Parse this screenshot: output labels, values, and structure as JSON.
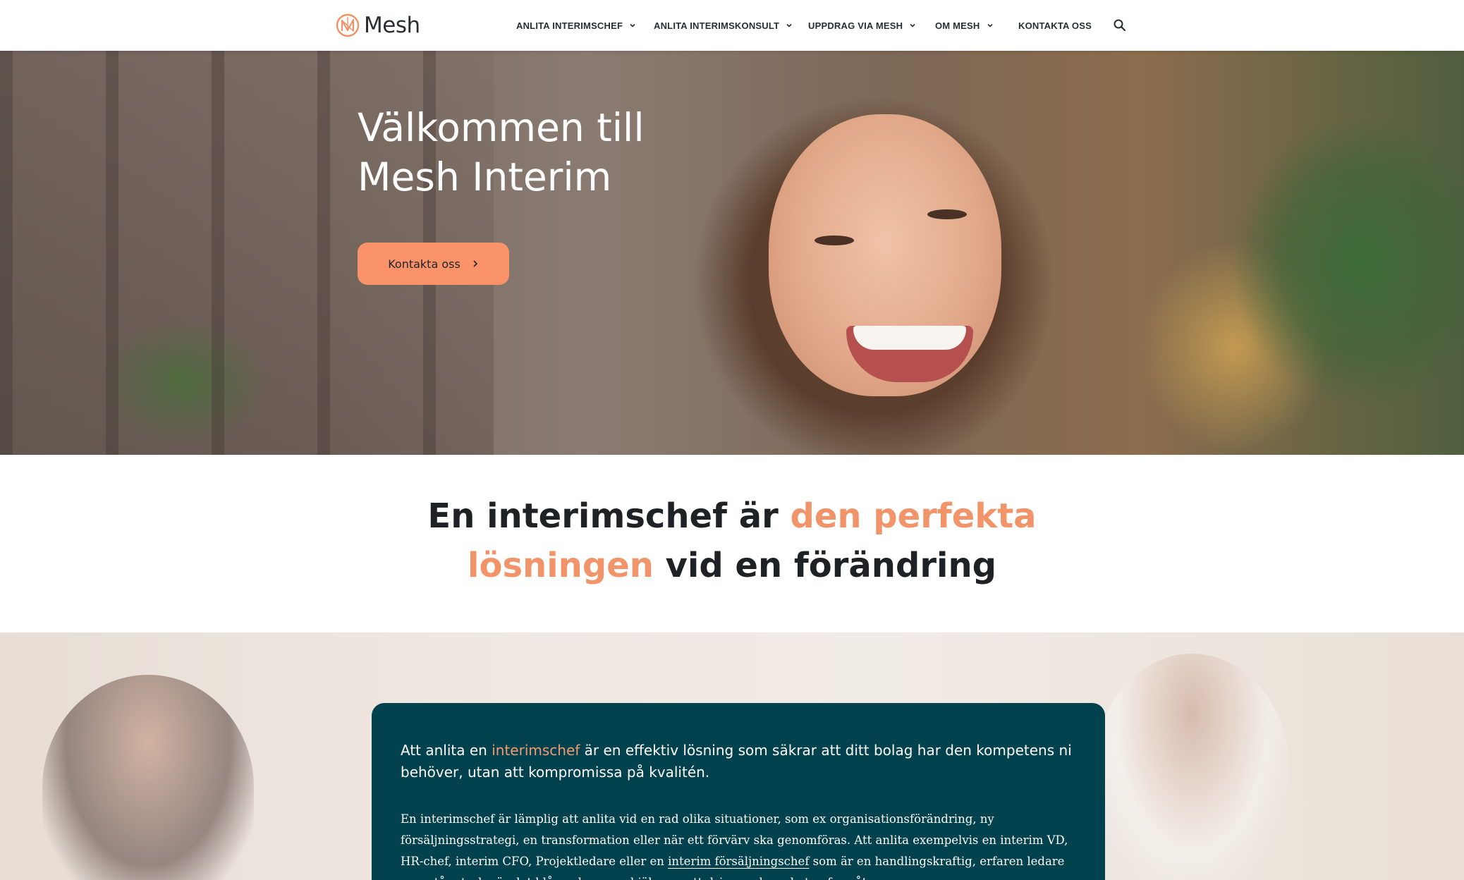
{
  "header": {
    "logo_text": "Mesh",
    "logo_icon": "mesh-logo-icon",
    "nav": [
      {
        "label": "ANLITA INTERIMSCHEF",
        "dropdown": true
      },
      {
        "label": "ANLITA INTERIMSKONSULT",
        "dropdown": true
      },
      {
        "label": "UPPDRAG VIA MESH",
        "dropdown": true
      },
      {
        "label": "OM MESH",
        "dropdown": true
      },
      {
        "label": "KONTAKTA OSS",
        "dropdown": false
      }
    ],
    "search_icon": "search-icon"
  },
  "hero": {
    "title": "Välkommen till Mesh Interim",
    "cta_label": "Kontakta oss",
    "cta_icon": "chevron-right-icon"
  },
  "headline": {
    "part1": "En interimschef är ",
    "accent": "den perfekta lösningen",
    "part2": " vid en förändring"
  },
  "card": {
    "lead_part1": "Att anlita en ",
    "lead_accent": "interimschef",
    "lead_part2": " är en effektiv lösning som säkrar att ditt bolag har den kompetens ni behöver, utan att kompromissa på kvalitén.",
    "body_part1": "En interimschef är lämplig att anlita vid en rad olika situationer, som ex organisationsförändring, ny försäljningsstrategi, en transformation eller när ett förvärv ska genomföras. Att anlita exempelvis en interim VD, HR-chef, interim CFO, Projektledare eller en ",
    "body_link": "interim försäljningschef",
    "body_part2": " som är en handlingskraftig, erfaren ledare som står stark när det blåser, kommer hjälpa er att driva verksamheten framåt."
  },
  "colors": {
    "accent": "#fa936a",
    "accent_text": "#f2946a",
    "card_bg": "#02424f",
    "text_dark": "#1f2225"
  }
}
